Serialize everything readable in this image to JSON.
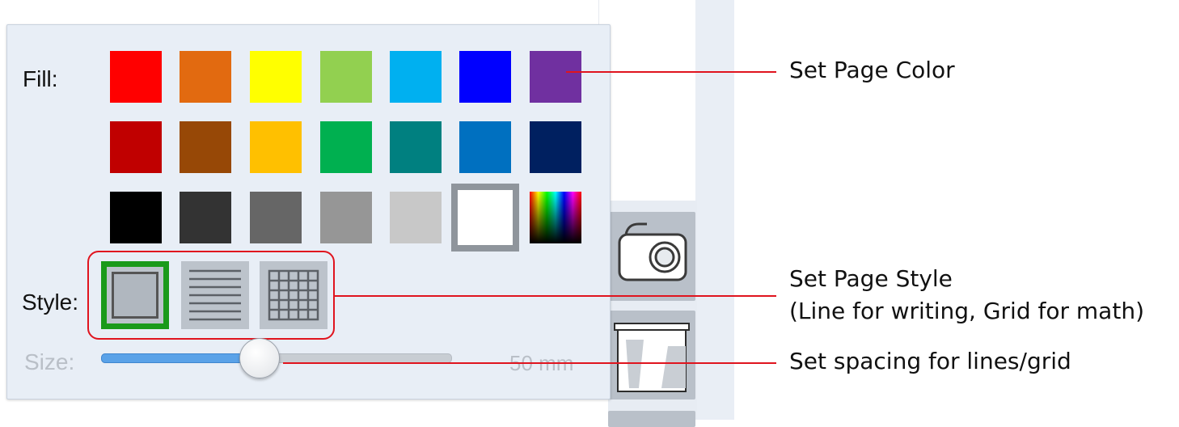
{
  "popup": {
    "fill_label": "Fill:",
    "style_label": "Style:",
    "size_label": "Size:",
    "size_value": "50 mm",
    "size_fraction": 0.45
  },
  "swatches": [
    [
      "#ff0000",
      "#e26a10",
      "#ffff00",
      "#92d050",
      "#00b0f0",
      "#0000ff",
      "#7030a0"
    ],
    [
      "#c00000",
      "#974806",
      "#ffc000",
      "#00b050",
      "#008080",
      "#0070c0",
      "#002060"
    ],
    [
      "#000000",
      "#333333",
      "#666666",
      "#969696",
      "#c8c8c8",
      "#ffffff",
      "spectrum"
    ]
  ],
  "selected_swatch": "#ffffff",
  "style_options": [
    "plain",
    "lines",
    "grid"
  ],
  "selected_style": "plain",
  "callouts": {
    "color": "Set Page Color",
    "style_line1": "Set Page Style",
    "style_line2": "(Line for writing, Grid for math)",
    "size": "Set spacing for lines/grid"
  },
  "sidebar": {
    "icons": [
      "camera-icon",
      "page-icon"
    ]
  },
  "colors": {
    "accent_red": "#e0141e",
    "selected_green": "#1a9a1a",
    "slider_blue": "#5aa2e8"
  }
}
